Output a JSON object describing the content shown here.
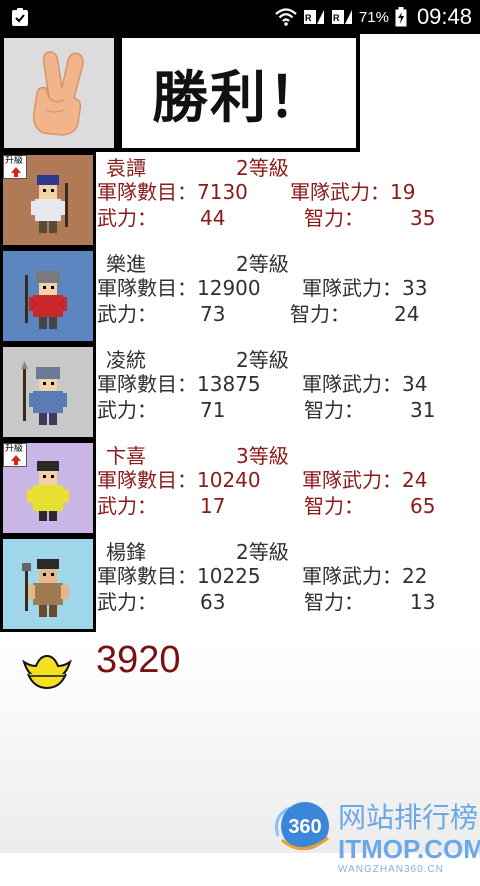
{
  "status_bar": {
    "battery_percent": "71%",
    "time": "09:48"
  },
  "result": {
    "text": "勝利！"
  },
  "generals": [
    {
      "name": "袁譚",
      "level": "2等級",
      "highlight": true,
      "upgrade": true,
      "troops_label": "軍隊數目：",
      "troops": "7130",
      "power_label": "軍隊武力：",
      "power": "19",
      "wu_label": "武力：",
      "wu": "44",
      "zhi_label": "智力：",
      "zhi": "35"
    },
    {
      "name": "樂進",
      "level": "2等級",
      "highlight": false,
      "upgrade": false,
      "troops_label": "軍隊數目：",
      "troops": "12900",
      "power_label": "軍隊武力：",
      "power": "33",
      "wu_label": "武力：",
      "wu": "73",
      "zhi_label": "智力：",
      "zhi": "24"
    },
    {
      "name": "凌統",
      "level": "2等級",
      "highlight": false,
      "upgrade": false,
      "troops_label": "軍隊數目：",
      "troops": "13875",
      "power_label": "軍隊武力：",
      "power": "34",
      "wu_label": "武力：",
      "wu": "71",
      "zhi_label": "智力：",
      "zhi": "31"
    },
    {
      "name": "卞喜",
      "level": "3等級",
      "highlight": true,
      "upgrade": true,
      "troops_label": "軍隊數目：",
      "troops": "10240",
      "power_label": "軍隊武力：",
      "power": "24",
      "wu_label": "武力：",
      "wu": "17",
      "zhi_label": "智力：",
      "zhi": "65"
    },
    {
      "name": "楊鋒",
      "level": "2等級",
      "highlight": false,
      "upgrade": false,
      "troops_label": "軍隊數目：",
      "troops": "10225",
      "power_label": "軍隊武力：",
      "power": "22",
      "wu_label": "武力：",
      "wu": "63",
      "zhi_label": "智力：",
      "zhi": "13"
    }
  ],
  "upgrade_badge": "升級",
  "gold": {
    "amount": "3920"
  },
  "watermark": {
    "logo_text": "360",
    "cn": "网站排行榜",
    "en": "ITMOP.COM",
    "sub": "WANGZHAN360.CN"
  },
  "colors": {
    "highlight_text": "#8b1a1a",
    "normal_text": "#303030",
    "gold_text": "#7a1010",
    "portrait_backgrounds": [
      "#b07a56",
      "#5b86c0",
      "#c8c8c8",
      "#c9b6e6",
      "#9fd6ea"
    ]
  }
}
